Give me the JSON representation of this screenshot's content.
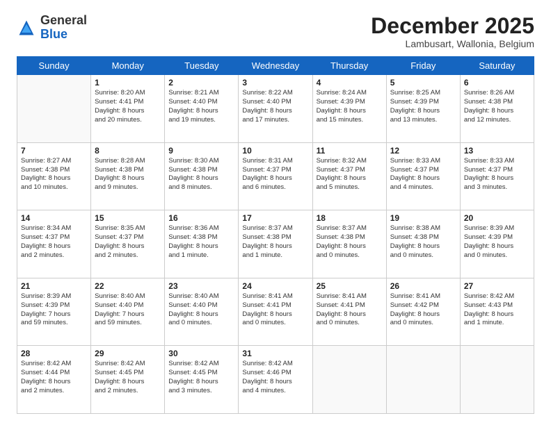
{
  "logo": {
    "general": "General",
    "blue": "Blue"
  },
  "header": {
    "month": "December 2025",
    "location": "Lambusart, Wallonia, Belgium"
  },
  "weekdays": [
    "Sunday",
    "Monday",
    "Tuesday",
    "Wednesday",
    "Thursday",
    "Friday",
    "Saturday"
  ],
  "weeks": [
    [
      {
        "day": "",
        "content": ""
      },
      {
        "day": "1",
        "content": "Sunrise: 8:20 AM\nSunset: 4:41 PM\nDaylight: 8 hours\nand 20 minutes."
      },
      {
        "day": "2",
        "content": "Sunrise: 8:21 AM\nSunset: 4:40 PM\nDaylight: 8 hours\nand 19 minutes."
      },
      {
        "day": "3",
        "content": "Sunrise: 8:22 AM\nSunset: 4:40 PM\nDaylight: 8 hours\nand 17 minutes."
      },
      {
        "day": "4",
        "content": "Sunrise: 8:24 AM\nSunset: 4:39 PM\nDaylight: 8 hours\nand 15 minutes."
      },
      {
        "day": "5",
        "content": "Sunrise: 8:25 AM\nSunset: 4:39 PM\nDaylight: 8 hours\nand 13 minutes."
      },
      {
        "day": "6",
        "content": "Sunrise: 8:26 AM\nSunset: 4:38 PM\nDaylight: 8 hours\nand 12 minutes."
      }
    ],
    [
      {
        "day": "7",
        "content": "Sunrise: 8:27 AM\nSunset: 4:38 PM\nDaylight: 8 hours\nand 10 minutes."
      },
      {
        "day": "8",
        "content": "Sunrise: 8:28 AM\nSunset: 4:38 PM\nDaylight: 8 hours\nand 9 minutes."
      },
      {
        "day": "9",
        "content": "Sunrise: 8:30 AM\nSunset: 4:38 PM\nDaylight: 8 hours\nand 8 minutes."
      },
      {
        "day": "10",
        "content": "Sunrise: 8:31 AM\nSunset: 4:37 PM\nDaylight: 8 hours\nand 6 minutes."
      },
      {
        "day": "11",
        "content": "Sunrise: 8:32 AM\nSunset: 4:37 PM\nDaylight: 8 hours\nand 5 minutes."
      },
      {
        "day": "12",
        "content": "Sunrise: 8:33 AM\nSunset: 4:37 PM\nDaylight: 8 hours\nand 4 minutes."
      },
      {
        "day": "13",
        "content": "Sunrise: 8:33 AM\nSunset: 4:37 PM\nDaylight: 8 hours\nand 3 minutes."
      }
    ],
    [
      {
        "day": "14",
        "content": "Sunrise: 8:34 AM\nSunset: 4:37 PM\nDaylight: 8 hours\nand 2 minutes."
      },
      {
        "day": "15",
        "content": "Sunrise: 8:35 AM\nSunset: 4:37 PM\nDaylight: 8 hours\nand 2 minutes."
      },
      {
        "day": "16",
        "content": "Sunrise: 8:36 AM\nSunset: 4:38 PM\nDaylight: 8 hours\nand 1 minute."
      },
      {
        "day": "17",
        "content": "Sunrise: 8:37 AM\nSunset: 4:38 PM\nDaylight: 8 hours\nand 1 minute."
      },
      {
        "day": "18",
        "content": "Sunrise: 8:37 AM\nSunset: 4:38 PM\nDaylight: 8 hours\nand 0 minutes."
      },
      {
        "day": "19",
        "content": "Sunrise: 8:38 AM\nSunset: 4:38 PM\nDaylight: 8 hours\nand 0 minutes."
      },
      {
        "day": "20",
        "content": "Sunrise: 8:39 AM\nSunset: 4:39 PM\nDaylight: 8 hours\nand 0 minutes."
      }
    ],
    [
      {
        "day": "21",
        "content": "Sunrise: 8:39 AM\nSunset: 4:39 PM\nDaylight: 7 hours\nand 59 minutes."
      },
      {
        "day": "22",
        "content": "Sunrise: 8:40 AM\nSunset: 4:40 PM\nDaylight: 7 hours\nand 59 minutes."
      },
      {
        "day": "23",
        "content": "Sunrise: 8:40 AM\nSunset: 4:40 PM\nDaylight: 8 hours\nand 0 minutes."
      },
      {
        "day": "24",
        "content": "Sunrise: 8:41 AM\nSunset: 4:41 PM\nDaylight: 8 hours\nand 0 minutes."
      },
      {
        "day": "25",
        "content": "Sunrise: 8:41 AM\nSunset: 4:41 PM\nDaylight: 8 hours\nand 0 minutes."
      },
      {
        "day": "26",
        "content": "Sunrise: 8:41 AM\nSunset: 4:42 PM\nDaylight: 8 hours\nand 0 minutes."
      },
      {
        "day": "27",
        "content": "Sunrise: 8:42 AM\nSunset: 4:43 PM\nDaylight: 8 hours\nand 1 minute."
      }
    ],
    [
      {
        "day": "28",
        "content": "Sunrise: 8:42 AM\nSunset: 4:44 PM\nDaylight: 8 hours\nand 2 minutes."
      },
      {
        "day": "29",
        "content": "Sunrise: 8:42 AM\nSunset: 4:45 PM\nDaylight: 8 hours\nand 2 minutes."
      },
      {
        "day": "30",
        "content": "Sunrise: 8:42 AM\nSunset: 4:45 PM\nDaylight: 8 hours\nand 3 minutes."
      },
      {
        "day": "31",
        "content": "Sunrise: 8:42 AM\nSunset: 4:46 PM\nDaylight: 8 hours\nand 4 minutes."
      },
      {
        "day": "",
        "content": ""
      },
      {
        "day": "",
        "content": ""
      },
      {
        "day": "",
        "content": ""
      }
    ]
  ]
}
